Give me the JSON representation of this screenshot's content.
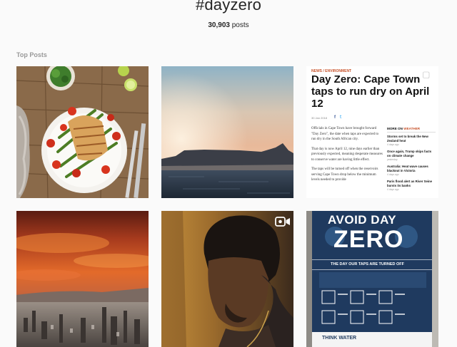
{
  "header": {
    "hashtag": "#dayzero",
    "post_count": "30,903",
    "post_suffix": " posts"
  },
  "section": {
    "title": "Top Posts"
  },
  "posts": [
    {
      "kind": "image",
      "icon": "none"
    },
    {
      "kind": "image",
      "icon": "none"
    },
    {
      "kind": "article",
      "icon": "multiple-photos-icon",
      "category": "NEWS / ENVIRONMENT",
      "headline": "Day Zero: Cape Town taps to run dry on April 12",
      "date": "30 Jan 2018",
      "share_fb": "f",
      "share_tw": "t",
      "body": [
        "Officials in Cape Town have brought forward \"Day Zero\", the date when taps are expected to run dry in the South African city.",
        "That day is now April 12, nine days earlier than previously expected, meaning desperate measures to conserve water are having little effect.",
        "The taps will be turned off when the reservoirs serving Cape Town drop below the minimum levels needed to provide"
      ],
      "side_title_prefix": "MORE ON",
      "side_title_topic": "WEATHER",
      "side_items": [
        {
          "text": "Storms set to break the New Zealand heat",
          "time": "4 days ago"
        },
        {
          "text": "Once again, Trump skips facts on climate change",
          "time": "yesterday"
        },
        {
          "text": "Australia: Heat wave causes blackout in Victoria",
          "time": "4 days ago"
        },
        {
          "text": "Paris flood alert as River Seine bursts its banks",
          "time": "4 days ago"
        }
      ]
    },
    {
      "kind": "image",
      "icon": "none"
    },
    {
      "kind": "video",
      "icon": "video-icon"
    },
    {
      "kind": "poster",
      "icon": "none",
      "title_line1": "AVOID DAY",
      "title_line2": "ZERO",
      "subtitle": "THE DAY OUR TAPS ARE TURNED OFF",
      "footer": "THINK WATER"
    }
  ],
  "colors": {
    "background": "#fafafa",
    "accent": "#c7522a",
    "poster_bg": "#1f3a5f"
  }
}
